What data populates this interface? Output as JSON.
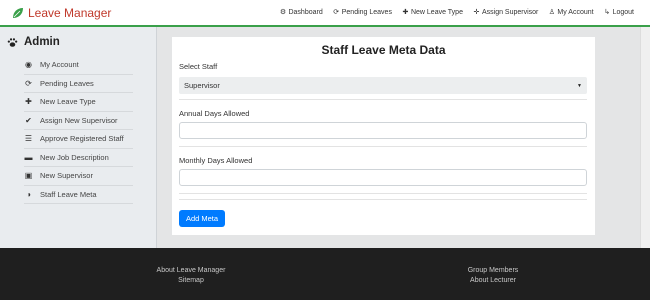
{
  "brand": {
    "name": "Leave Manager",
    "color": "#c0392b"
  },
  "nav": [
    {
      "label": "Dashboard",
      "icon": "dashboard-icon",
      "glyph": "⚙"
    },
    {
      "label": "Pending Leaves",
      "icon": "refresh-icon",
      "glyph": "⟳"
    },
    {
      "label": "New Leave Type",
      "icon": "plus-icon",
      "glyph": "✚"
    },
    {
      "label": "Assign Supervisor",
      "icon": "crosshair-icon",
      "glyph": "✛"
    },
    {
      "label": "My Account",
      "icon": "user-icon",
      "glyph": "♙"
    },
    {
      "label": "Logout",
      "icon": "logout-icon",
      "glyph": "↳"
    }
  ],
  "sidebar": {
    "title": "Admin",
    "items": [
      {
        "label": "My Account",
        "icon": "user-circle-icon",
        "glyph": "◉"
      },
      {
        "label": "Pending Leaves",
        "icon": "refresh-icon",
        "glyph": "⟳"
      },
      {
        "label": "New Leave Type",
        "icon": "plus-icon",
        "glyph": "✚"
      },
      {
        "label": "Assign New Supervisor",
        "icon": "check-icon",
        "glyph": "✔"
      },
      {
        "label": "Approve Registered Staff",
        "icon": "list-icon",
        "glyph": "☰"
      },
      {
        "label": "New Job Description",
        "icon": "briefcase-icon",
        "glyph": "▬"
      },
      {
        "label": "New Supervisor",
        "icon": "id-card-icon",
        "glyph": "▣"
      },
      {
        "label": "Staff Leave Meta",
        "icon": "adjust-icon",
        "glyph": "◑"
      }
    ]
  },
  "form": {
    "title": "Staff Leave Meta Data",
    "staff_label": "Select Staff",
    "staff_value": "Supervisor",
    "annual_label": "Annual Days Allowed",
    "annual_value": "",
    "monthly_label": "Monthly Days Allowed",
    "monthly_value": "",
    "submit_label": "Add Meta",
    "accent": "#007bff"
  },
  "footer": {
    "left": [
      "About Leave Manager",
      "Sitemap"
    ],
    "right": [
      "Group Members",
      "About Lecturer"
    ]
  }
}
